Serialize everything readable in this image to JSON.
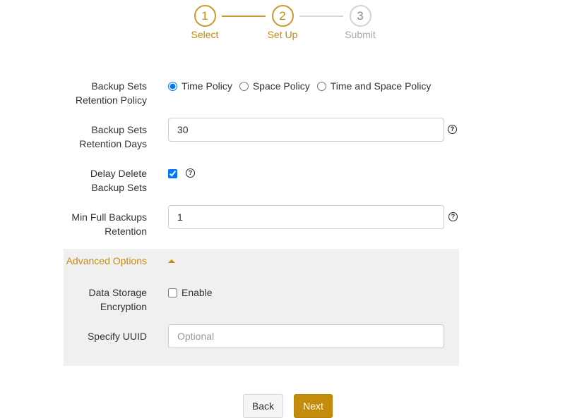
{
  "stepper": {
    "steps": [
      {
        "number": "1",
        "label": "Select",
        "state": "active"
      },
      {
        "number": "2",
        "label": "Set Up",
        "state": "active"
      },
      {
        "number": "3",
        "label": "Submit",
        "state": "inactive"
      }
    ]
  },
  "form": {
    "retention_policy": {
      "label_line1": "Backup Sets",
      "label_line2": "Retention Policy",
      "options": [
        "Time Policy",
        "Space Policy",
        "Time and Space Policy"
      ],
      "selected": "Time Policy"
    },
    "retention_days": {
      "label_line1": "Backup Sets",
      "label_line2": "Retention Days",
      "value": "30"
    },
    "delay_delete": {
      "label_line1": "Delay Delete",
      "label_line2": "Backup Sets",
      "checked": true
    },
    "min_full_backups": {
      "label_line1": "Min Full Backups",
      "label_line2": "Retention",
      "value": "1"
    }
  },
  "advanced": {
    "label": "Advanced Options",
    "expanded": true,
    "encryption": {
      "label_line1": "Data Storage",
      "label_line2": "Encryption",
      "checkbox_label": "Enable",
      "checked": false
    },
    "uuid": {
      "label": "Specify UUID",
      "value": "",
      "placeholder": "Optional"
    }
  },
  "buttons": {
    "back": "Back",
    "next": "Next"
  },
  "colors": {
    "accent": "#c48c0c",
    "inactive": "#a9a9a9",
    "panel_bg": "#f0f0f0"
  },
  "icons": {
    "help": "question-circle-icon",
    "collapse": "caret-up-icon"
  }
}
